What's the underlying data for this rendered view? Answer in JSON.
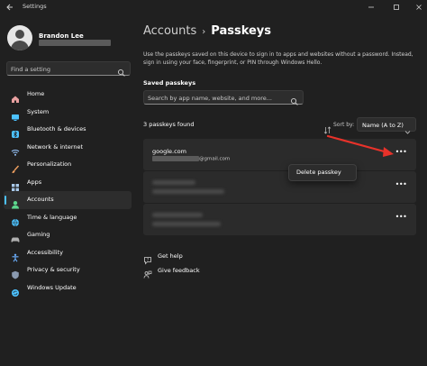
{
  "window": {
    "title": "Settings"
  },
  "user": {
    "name": "Brandon Lee"
  },
  "sidebar": {
    "search_placeholder": "Find a setting",
    "items": [
      {
        "label": "Home",
        "icon": "home-icon",
        "color": "#e8a0a0"
      },
      {
        "label": "System",
        "icon": "system-icon",
        "color": "#4cc2ff"
      },
      {
        "label": "Bluetooth & devices",
        "icon": "bluetooth-icon",
        "color": "#4cc2ff"
      },
      {
        "label": "Network & internet",
        "icon": "network-icon",
        "color": "#9ac8ff"
      },
      {
        "label": "Personalization",
        "icon": "brush-icon",
        "color": "#f0a060"
      },
      {
        "label": "Apps",
        "icon": "apps-icon",
        "color": "#a8c8e8"
      },
      {
        "label": "Accounts",
        "icon": "accounts-icon",
        "color": "#5cd68c",
        "active": true
      },
      {
        "label": "Time & language",
        "icon": "globe-icon",
        "color": "#4cc2ff"
      },
      {
        "label": "Gaming",
        "icon": "gamepad-icon",
        "color": "#b0b0b0"
      },
      {
        "label": "Accessibility",
        "icon": "accessibility-icon",
        "color": "#6cb0ff"
      },
      {
        "label": "Privacy & security",
        "icon": "shield-icon",
        "color": "#8a9ab0"
      },
      {
        "label": "Windows Update",
        "icon": "update-icon",
        "color": "#4cc2ff"
      }
    ]
  },
  "breadcrumb": {
    "parent": "Accounts",
    "separator": "›",
    "current": "Passkeys"
  },
  "description": "Use the passkeys saved on this device to sign in to apps and websites without a password. Instead, sign in using your face, fingerprint, or PIN through Windows Hello.",
  "saved": {
    "title": "Saved passkeys",
    "search_placeholder": "Search by app name, website, and more...",
    "count_text": "3 passkeys found",
    "sort_label": "Sort by:",
    "sort_value": "Name (A to Z)"
  },
  "passkeys": [
    {
      "site": "google.com",
      "user_suffix": "@gmail.com"
    }
  ],
  "context_menu": {
    "item": "Delete passkey"
  },
  "links": {
    "help": "Get help",
    "feedback": "Give feedback"
  },
  "colors": {
    "accent": "#4cc2ff",
    "annotation_arrow": "#e8322a"
  }
}
